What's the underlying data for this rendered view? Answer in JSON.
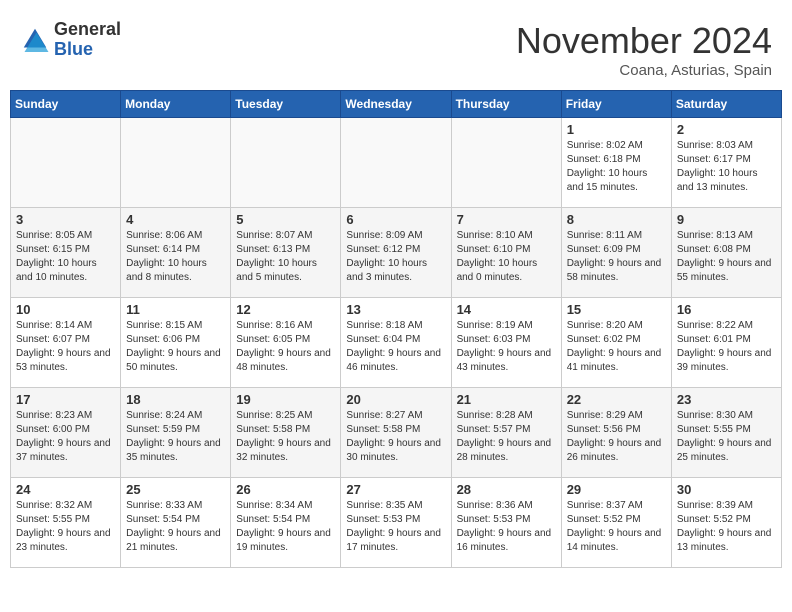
{
  "header": {
    "logo_line1": "General",
    "logo_line2": "Blue",
    "month_title": "November 2024",
    "location": "Coana, Asturias, Spain"
  },
  "weekdays": [
    "Sunday",
    "Monday",
    "Tuesday",
    "Wednesday",
    "Thursday",
    "Friday",
    "Saturday"
  ],
  "weeks": [
    [
      {
        "day": "",
        "info": ""
      },
      {
        "day": "",
        "info": ""
      },
      {
        "day": "",
        "info": ""
      },
      {
        "day": "",
        "info": ""
      },
      {
        "day": "",
        "info": ""
      },
      {
        "day": "1",
        "info": "Sunrise: 8:02 AM\nSunset: 6:18 PM\nDaylight: 10 hours and 15 minutes."
      },
      {
        "day": "2",
        "info": "Sunrise: 8:03 AM\nSunset: 6:17 PM\nDaylight: 10 hours and 13 minutes."
      }
    ],
    [
      {
        "day": "3",
        "info": "Sunrise: 8:05 AM\nSunset: 6:15 PM\nDaylight: 10 hours and 10 minutes."
      },
      {
        "day": "4",
        "info": "Sunrise: 8:06 AM\nSunset: 6:14 PM\nDaylight: 10 hours and 8 minutes."
      },
      {
        "day": "5",
        "info": "Sunrise: 8:07 AM\nSunset: 6:13 PM\nDaylight: 10 hours and 5 minutes."
      },
      {
        "day": "6",
        "info": "Sunrise: 8:09 AM\nSunset: 6:12 PM\nDaylight: 10 hours and 3 minutes."
      },
      {
        "day": "7",
        "info": "Sunrise: 8:10 AM\nSunset: 6:10 PM\nDaylight: 10 hours and 0 minutes."
      },
      {
        "day": "8",
        "info": "Sunrise: 8:11 AM\nSunset: 6:09 PM\nDaylight: 9 hours and 58 minutes."
      },
      {
        "day": "9",
        "info": "Sunrise: 8:13 AM\nSunset: 6:08 PM\nDaylight: 9 hours and 55 minutes."
      }
    ],
    [
      {
        "day": "10",
        "info": "Sunrise: 8:14 AM\nSunset: 6:07 PM\nDaylight: 9 hours and 53 minutes."
      },
      {
        "day": "11",
        "info": "Sunrise: 8:15 AM\nSunset: 6:06 PM\nDaylight: 9 hours and 50 minutes."
      },
      {
        "day": "12",
        "info": "Sunrise: 8:16 AM\nSunset: 6:05 PM\nDaylight: 9 hours and 48 minutes."
      },
      {
        "day": "13",
        "info": "Sunrise: 8:18 AM\nSunset: 6:04 PM\nDaylight: 9 hours and 46 minutes."
      },
      {
        "day": "14",
        "info": "Sunrise: 8:19 AM\nSunset: 6:03 PM\nDaylight: 9 hours and 43 minutes."
      },
      {
        "day": "15",
        "info": "Sunrise: 8:20 AM\nSunset: 6:02 PM\nDaylight: 9 hours and 41 minutes."
      },
      {
        "day": "16",
        "info": "Sunrise: 8:22 AM\nSunset: 6:01 PM\nDaylight: 9 hours and 39 minutes."
      }
    ],
    [
      {
        "day": "17",
        "info": "Sunrise: 8:23 AM\nSunset: 6:00 PM\nDaylight: 9 hours and 37 minutes."
      },
      {
        "day": "18",
        "info": "Sunrise: 8:24 AM\nSunset: 5:59 PM\nDaylight: 9 hours and 35 minutes."
      },
      {
        "day": "19",
        "info": "Sunrise: 8:25 AM\nSunset: 5:58 PM\nDaylight: 9 hours and 32 minutes."
      },
      {
        "day": "20",
        "info": "Sunrise: 8:27 AM\nSunset: 5:58 PM\nDaylight: 9 hours and 30 minutes."
      },
      {
        "day": "21",
        "info": "Sunrise: 8:28 AM\nSunset: 5:57 PM\nDaylight: 9 hours and 28 minutes."
      },
      {
        "day": "22",
        "info": "Sunrise: 8:29 AM\nSunset: 5:56 PM\nDaylight: 9 hours and 26 minutes."
      },
      {
        "day": "23",
        "info": "Sunrise: 8:30 AM\nSunset: 5:55 PM\nDaylight: 9 hours and 25 minutes."
      }
    ],
    [
      {
        "day": "24",
        "info": "Sunrise: 8:32 AM\nSunset: 5:55 PM\nDaylight: 9 hours and 23 minutes."
      },
      {
        "day": "25",
        "info": "Sunrise: 8:33 AM\nSunset: 5:54 PM\nDaylight: 9 hours and 21 minutes."
      },
      {
        "day": "26",
        "info": "Sunrise: 8:34 AM\nSunset: 5:54 PM\nDaylight: 9 hours and 19 minutes."
      },
      {
        "day": "27",
        "info": "Sunrise: 8:35 AM\nSunset: 5:53 PM\nDaylight: 9 hours and 17 minutes."
      },
      {
        "day": "28",
        "info": "Sunrise: 8:36 AM\nSunset: 5:53 PM\nDaylight: 9 hours and 16 minutes."
      },
      {
        "day": "29",
        "info": "Sunrise: 8:37 AM\nSunset: 5:52 PM\nDaylight: 9 hours and 14 minutes."
      },
      {
        "day": "30",
        "info": "Sunrise: 8:39 AM\nSunset: 5:52 PM\nDaylight: 9 hours and 13 minutes."
      }
    ]
  ]
}
